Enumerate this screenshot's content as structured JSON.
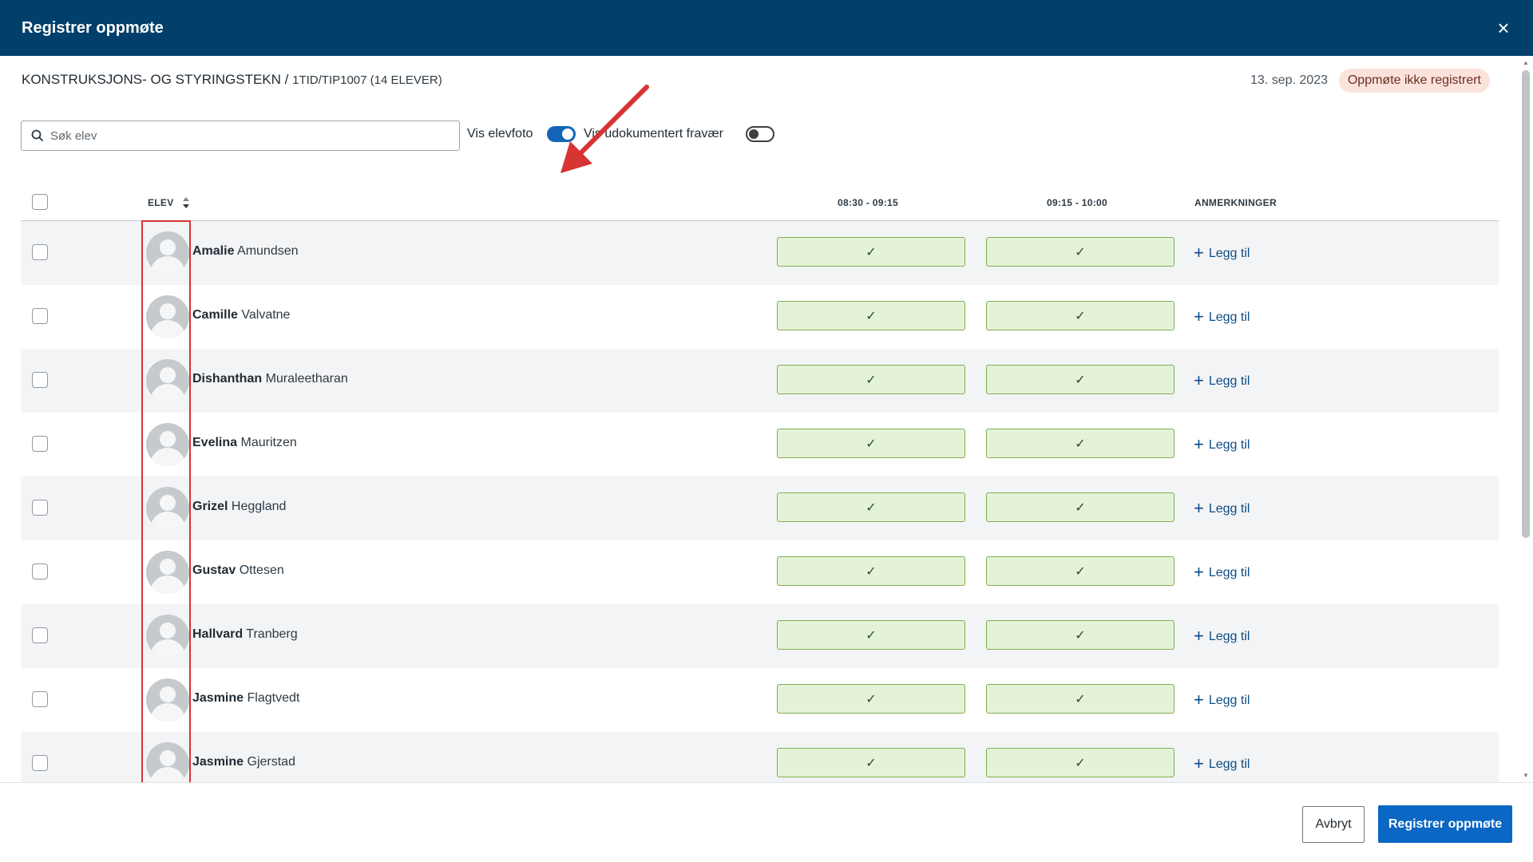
{
  "dialog": {
    "title": "Registrer oppmøte",
    "close_icon": "×"
  },
  "course": {
    "name": "KONSTRUKSJONS- OG STYRINGSTEKN",
    "separator": " / ",
    "group": "1TID/TIP1007 (14 ELEVER)"
  },
  "date": "13. sep. 2023",
  "status": {
    "label": "Oppmøte ikke registrert",
    "color": "#fbe3dc"
  },
  "search": {
    "placeholder": "Søk elev",
    "value": ""
  },
  "toggles": {
    "photo": {
      "label": "Vis elevfoto",
      "on": true
    },
    "undocumented": {
      "label": "Vis udokumentert fravær",
      "on": false
    }
  },
  "table": {
    "columns": {
      "student": "ELEV",
      "slot1": "08:30 - 09:15",
      "slot2": "09:15 - 10:00",
      "remarks": "ANMERKNINGER"
    },
    "add_label": "Legg til",
    "check_mark": "✓",
    "rows": [
      {
        "first": "Amalie",
        "last": "Amundsen"
      },
      {
        "first": "Camille",
        "last": "Valvatne"
      },
      {
        "first": "Dishanthan",
        "last": "Muraleetharan"
      },
      {
        "first": "Evelina",
        "last": "Mauritzen"
      },
      {
        "first": "Grizel",
        "last": "Heggland"
      },
      {
        "first": "Gustav",
        "last": "Ottesen"
      },
      {
        "first": "Hallvard",
        "last": "Tranberg"
      },
      {
        "first": "Jasmine",
        "last": "Flagtvedt"
      },
      {
        "first": "Jasmine",
        "last": "Gjerstad"
      }
    ]
  },
  "footer": {
    "cancel": "Avbryt",
    "submit": "Registrer oppmøte"
  },
  "colors": {
    "header": "#023f6a",
    "primary": "#0a67c3",
    "present": "#e4f3d7",
    "annotation": "#d73434"
  }
}
